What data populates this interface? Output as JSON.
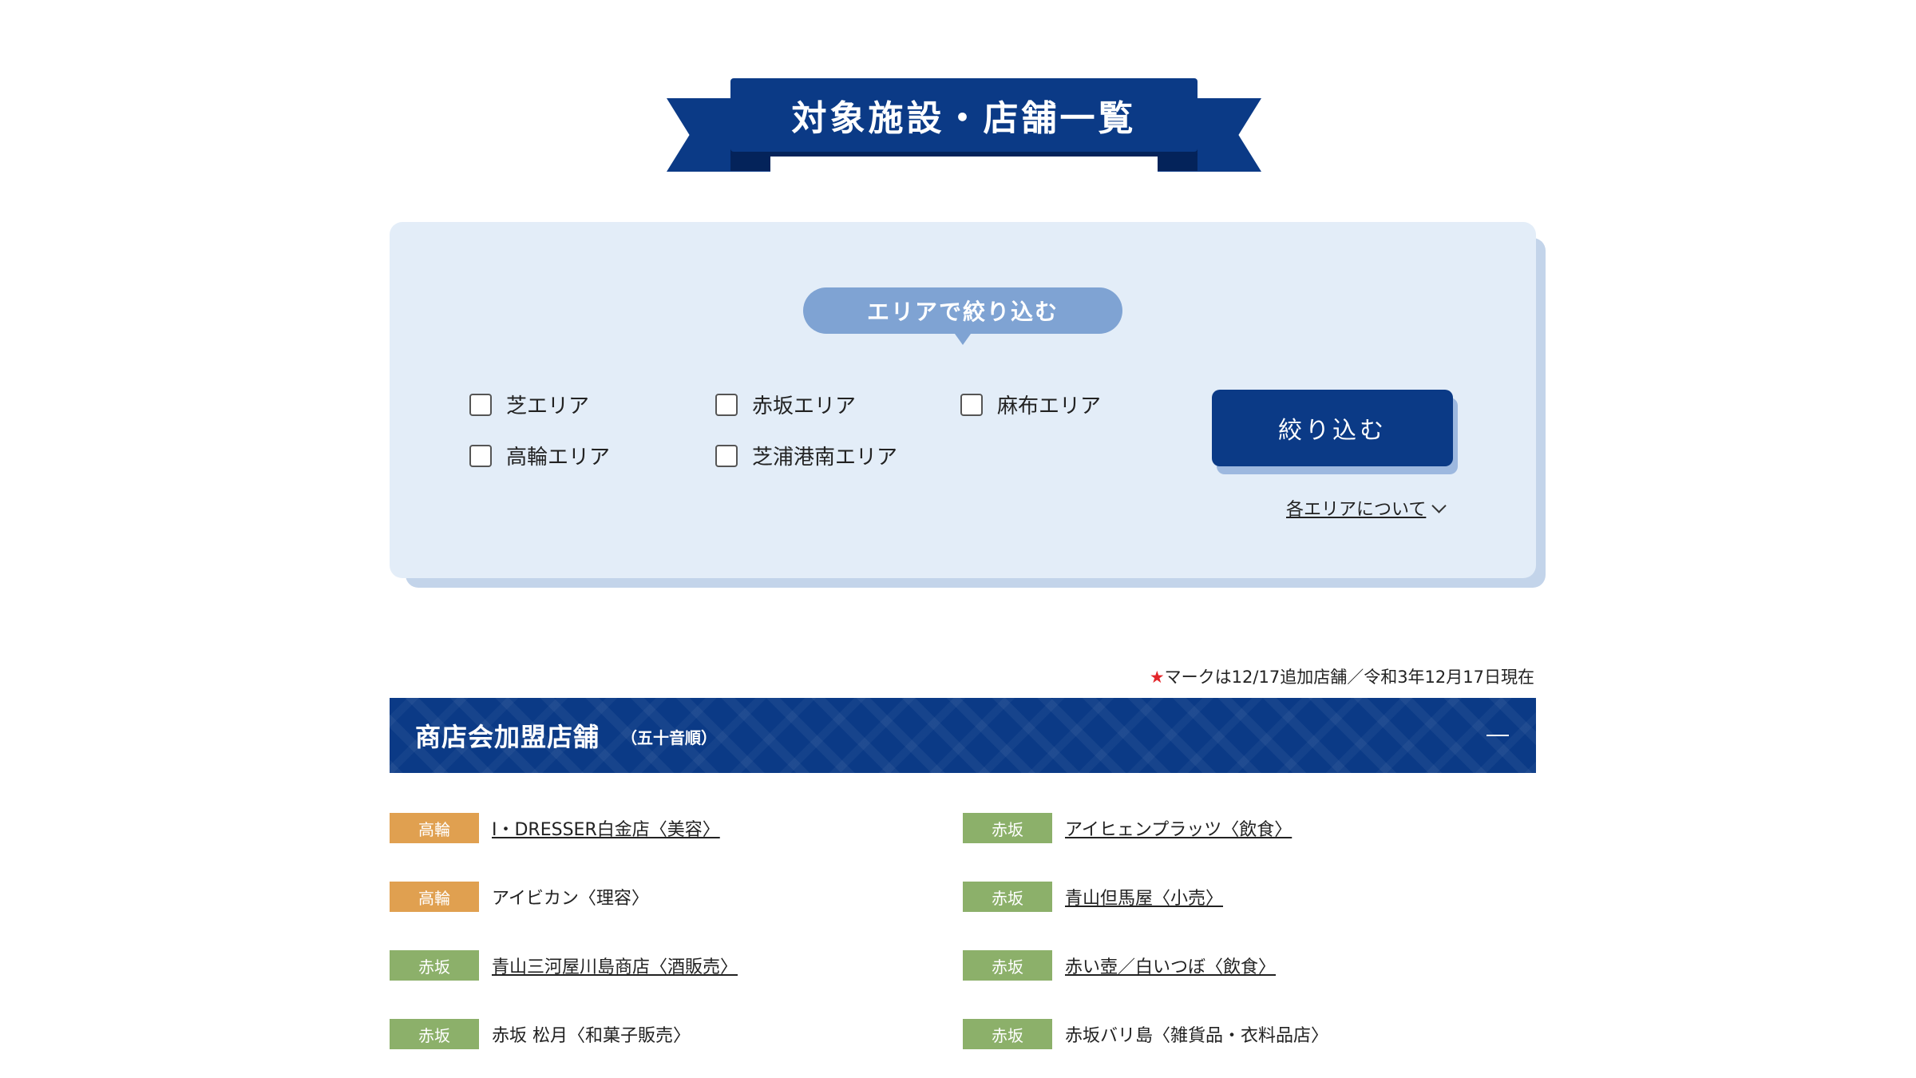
{
  "page_title": "対象施設・店舗一覧",
  "filter": {
    "heading": "エリアで絞り込む",
    "options": [
      "芝エリア",
      "赤坂エリア",
      "麻布エリア",
      "高輪エリア",
      "芝浦港南エリア"
    ],
    "apply_label": "絞り込む",
    "area_info_label": "各エリアについて"
  },
  "note": {
    "star": "★",
    "text": "マークは12/17追加店舗／令和3年12月17日現在"
  },
  "section": {
    "title": "商店会加盟店舗",
    "subtitle": "（五十音順）",
    "stores": [
      {
        "area": "高輪",
        "name": "I・DRESSER白金店〈美容〉"
      },
      {
        "area": "赤坂",
        "name": "アイヒェンプラッツ〈飲食〉"
      },
      {
        "area": "高輪",
        "name": "アイビカン〈理容〉"
      },
      {
        "area": "赤坂",
        "name": "青山但馬屋〈小売〉"
      },
      {
        "area": "赤坂",
        "name": "青山三河屋川島商店〈酒販売〉"
      },
      {
        "area": "赤坂",
        "name": "赤い壺／白いつぼ〈飲食〉"
      },
      {
        "area": "赤坂",
        "name": "赤坂 松月〈和菓子販売〉"
      },
      {
        "area": "赤坂",
        "name": "赤坂バリ島〈雑貨品・衣料品店〉"
      }
    ]
  }
}
